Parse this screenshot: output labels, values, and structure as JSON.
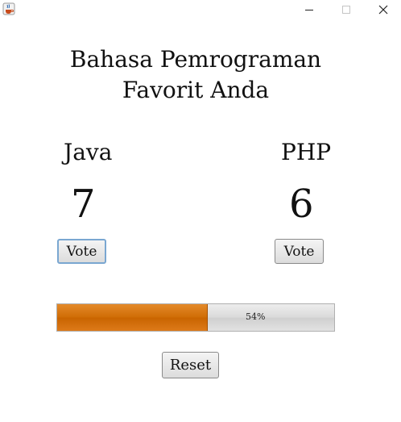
{
  "window": {
    "app_icon": "java-cup-icon"
  },
  "heading": {
    "line1": "Bahasa Pemrograman",
    "line2": "Favorit Anda"
  },
  "java": {
    "label": "Java",
    "count": "7",
    "vote_label": "Vote"
  },
  "php": {
    "label": "PHP",
    "count": "6",
    "vote_label": "Vote"
  },
  "progress": {
    "percent": 54,
    "text": "54%",
    "fill_color": "#cf6c05"
  },
  "reset": {
    "label": "Reset"
  }
}
